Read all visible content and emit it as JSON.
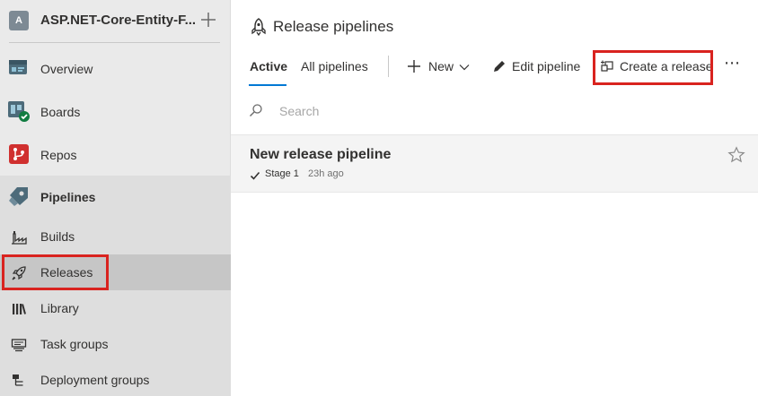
{
  "project": {
    "avatar_letter": "A",
    "name": "ASP.NET-Core-Entity-F..."
  },
  "sidebar": {
    "items": [
      {
        "label": "Overview",
        "icon": "overview-icon"
      },
      {
        "label": "Boards",
        "icon": "boards-icon"
      },
      {
        "label": "Repos",
        "icon": "repos-icon"
      },
      {
        "label": "Pipelines",
        "icon": "pipelines-icon"
      },
      {
        "label": "Builds",
        "icon": "builds-icon"
      },
      {
        "label": "Releases",
        "icon": "releases-rocket-icon",
        "selected": true
      },
      {
        "label": "Library",
        "icon": "library-icon"
      },
      {
        "label": "Task groups",
        "icon": "task-groups-icon"
      },
      {
        "label": "Deployment groups",
        "icon": "deployment-groups-icon"
      }
    ]
  },
  "header": {
    "title": "Release pipelines"
  },
  "toolbar": {
    "tabs": [
      {
        "label": "Active",
        "active": true
      },
      {
        "label": "All pipelines",
        "active": false
      }
    ],
    "new_label": "New",
    "edit_label": "Edit pipeline",
    "create_release_label": "Create a release",
    "more_label": "⋯"
  },
  "search": {
    "placeholder": "Search",
    "value": ""
  },
  "pipelines": [
    {
      "name": "New release pipeline",
      "stage": "Stage 1",
      "time": "23h ago",
      "stage_status": "succeeded"
    }
  ],
  "colors": {
    "accent": "#0078d4",
    "highlight_box": "#d9231f",
    "sidebar_bg": "#eaeaea",
    "selected_bg": "#c6c6c6"
  }
}
